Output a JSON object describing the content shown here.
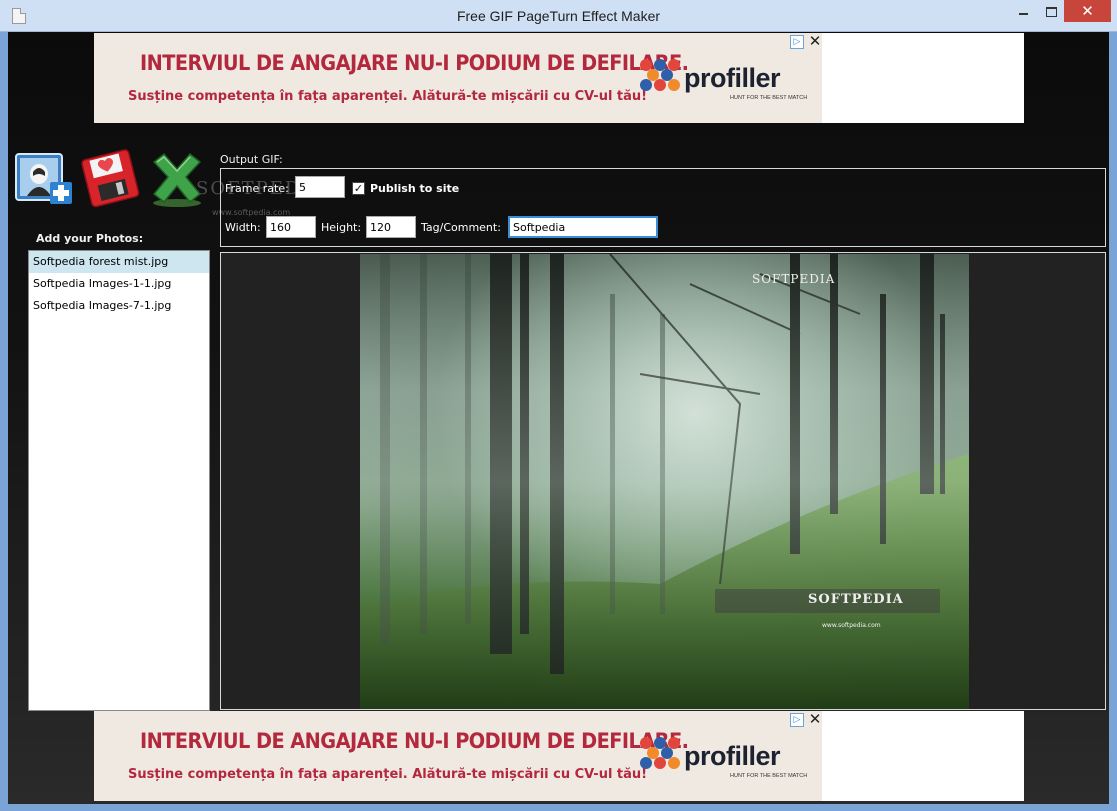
{
  "window": {
    "title": "Free GIF PageTurn Effect Maker",
    "close_glyph": "✕"
  },
  "ads": {
    "headline": "INTERVIUL DE ANGAJARE NU-I PODIUM DE DEFILARE.",
    "subline": "Susține competența în fața aparenței. Alătură-te mișcării cu CV-ul tău!",
    "brand": "profiller",
    "brand_tagline": "HUNT FOR THE BEST MATCH",
    "choices_glyph": "▷",
    "close_glyph": "✕"
  },
  "toolbar": {
    "add_icon": "add-photo-icon",
    "save_icon": "save-floppy-icon",
    "delete_icon": "delete-x-icon"
  },
  "photos": {
    "label": "Add your Photos:",
    "items": [
      {
        "name": "Softpedia forest mist.jpg",
        "selected": true
      },
      {
        "name": "Softpedia Images-1-1.jpg",
        "selected": false
      },
      {
        "name": "Softpedia Images-7-1.jpg",
        "selected": false
      }
    ]
  },
  "output": {
    "label": "Output GIF:",
    "frame_rate_label": "Frame rate:",
    "frame_rate": "5",
    "publish_label": "Publish to site",
    "publish_checked": true,
    "width_label": "Width:",
    "width": "160",
    "height_label": "Height:",
    "height": "120",
    "tag_label": "Tag/Comment:",
    "tag": "Softpedia"
  },
  "preview": {
    "watermark_top": "SOFTPEDIA",
    "watermark_bottom": "SOFTPEDIA",
    "watermark_url": "www.softpedia.com",
    "bg_watermark": "SOFTPEDIA",
    "bg_watermark_url": "www.softpedia.com"
  }
}
